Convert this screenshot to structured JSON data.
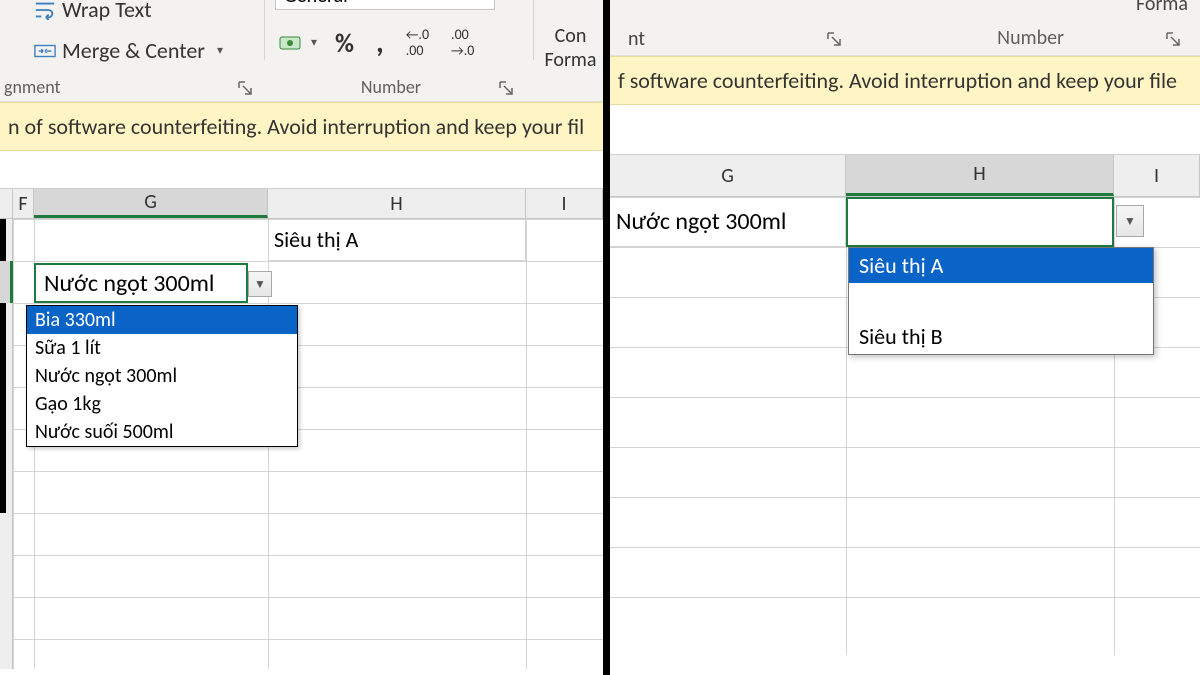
{
  "ribbon": {
    "wrap_text": "Wrap Text",
    "merge_center": "Merge & Center",
    "alignment_group": "gnment",
    "number_format": "General",
    "number_group": "Number",
    "cond_format_top": "Con",
    "cond_format_bottom": "Forma"
  },
  "ribbon_right": {
    "format": "Forma",
    "nt": "nt",
    "number_group": "Number"
  },
  "warning_left": "n of software counterfeiting. Avoid interruption and keep your fil",
  "warning_right": "f software counterfeiting. Avoid interruption and keep your file",
  "left_grid": {
    "cols": {
      "F": "F",
      "G": "G",
      "H": "H",
      "I": "I"
    },
    "h_value": "Siêu thị A",
    "active_value": "Nước ngọt 300ml",
    "dropdown": [
      "Bia 330ml",
      "Sữa 1 lít",
      "Nước ngọt 300ml",
      "Gạo 1kg",
      "Nước suối 500ml"
    ]
  },
  "right_grid": {
    "cols": {
      "G": "G",
      "H": "H",
      "I": "I"
    },
    "g_value": "Nước ngọt 300ml",
    "dropdown": [
      "Siêu thị A",
      "Siêu thị B"
    ]
  }
}
